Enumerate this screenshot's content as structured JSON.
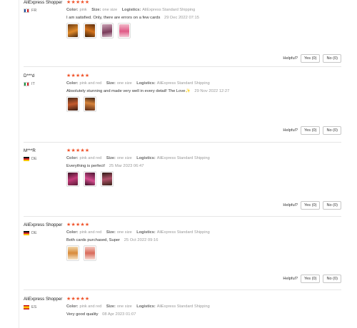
{
  "helpful_label": "Helpful?",
  "reviews": [
    {
      "user": "AliExpress Shopper",
      "country": "FR",
      "stars": "★★★★★",
      "color_label": "Color:",
      "color": "pink",
      "size_label": "Size:",
      "size": "one size",
      "logistics_label": "Logistics:",
      "logistics": "AliExpress Standard Shipping",
      "text": "I am satisfied. Only, there are errors on a few cards",
      "date": "29 Dec 2022 07:15",
      "yes": "Yes (0)",
      "no": "No (0)"
    },
    {
      "user": "D***d",
      "country": "IT",
      "stars": "★★★★★",
      "color_label": "Color:",
      "color": "pink and red",
      "size_label": "Size:",
      "size": "one size",
      "logistics_label": "Logistics:",
      "logistics": "AliExpress Standard Shipping",
      "text": "Absolutely stunning and made very well in every detail! The Love✨",
      "date": "29 Nov 2022 12:27",
      "yes": "Yes (0)",
      "no": "No (0)"
    },
    {
      "user": "M***R",
      "country": "DE",
      "stars": "★★★★★",
      "color_label": "Color:",
      "color": "pink and red",
      "size_label": "Size:",
      "size": "one size",
      "logistics_label": "Logistics:",
      "logistics": "AliExpress Standard Shipping",
      "text": "Everything is perfect!",
      "date": "25 Mar 2023 06:47",
      "yes": "Yes (0)",
      "no": "No (0)"
    },
    {
      "user": "AliExpress Shopper",
      "country": "DE",
      "stars": "★★★★★",
      "color_label": "Color:",
      "color": "pink and red",
      "size_label": "Size:",
      "size": "one size",
      "logistics_label": "Logistics:",
      "logistics": "AliExpress Standard Shipping",
      "text": "Both cards purchased, Super",
      "date": "25 Oct 2022 09:16",
      "yes": "Yes (0)",
      "no": "No (0)"
    },
    {
      "user": "AliExpress Shopper",
      "country": "ES",
      "stars": "★★★★★",
      "color_label": "Color:",
      "color": "pink and red",
      "size_label": "Size:",
      "size": "one size",
      "logistics_label": "Logistics:",
      "logistics": "AliExpress Standard Shipping",
      "text": "Very good quality",
      "date": "08 Apr 2023 01:07"
    }
  ]
}
